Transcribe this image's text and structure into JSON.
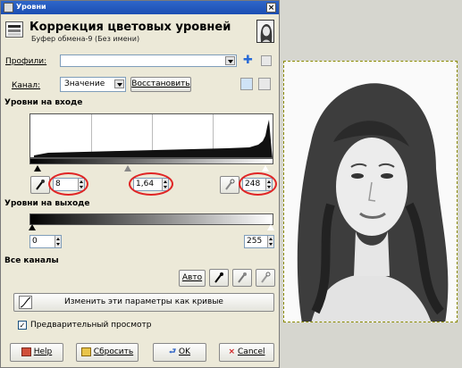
{
  "window": {
    "title": "Уровни",
    "close_glyph": "×"
  },
  "header": {
    "title": "Коррекция цветовых уровней",
    "subtitle": "Буфер обмена-9 (Без имени)"
  },
  "profiles": {
    "label": "Профили:",
    "value": ""
  },
  "channel": {
    "label": "Канал:",
    "value": "Значение",
    "reset_button": "Восстановить"
  },
  "input_levels": {
    "heading": "Уровни на входе",
    "low": "8",
    "gamma": "1,64",
    "high": "248"
  },
  "output_levels": {
    "heading": "Уровни на выходе",
    "low": "0",
    "high": "255"
  },
  "all_channels": {
    "heading": "Все каналы",
    "auto_button": "Авто"
  },
  "curves_button": "Изменить эти параметры как кривые",
  "preview": {
    "label": "Предварительный просмотр",
    "checked": true,
    "check_glyph": "✓"
  },
  "buttons": {
    "help": "Help",
    "reset": "Сбросить",
    "ok": "OK",
    "cancel": "Cancel"
  },
  "icons": {
    "plus": "✚",
    "close": "×"
  },
  "colors": {
    "titlebar": "#2358c4",
    "highlight_oval": "#e02525",
    "dialog_bg": "#ece9d8"
  }
}
